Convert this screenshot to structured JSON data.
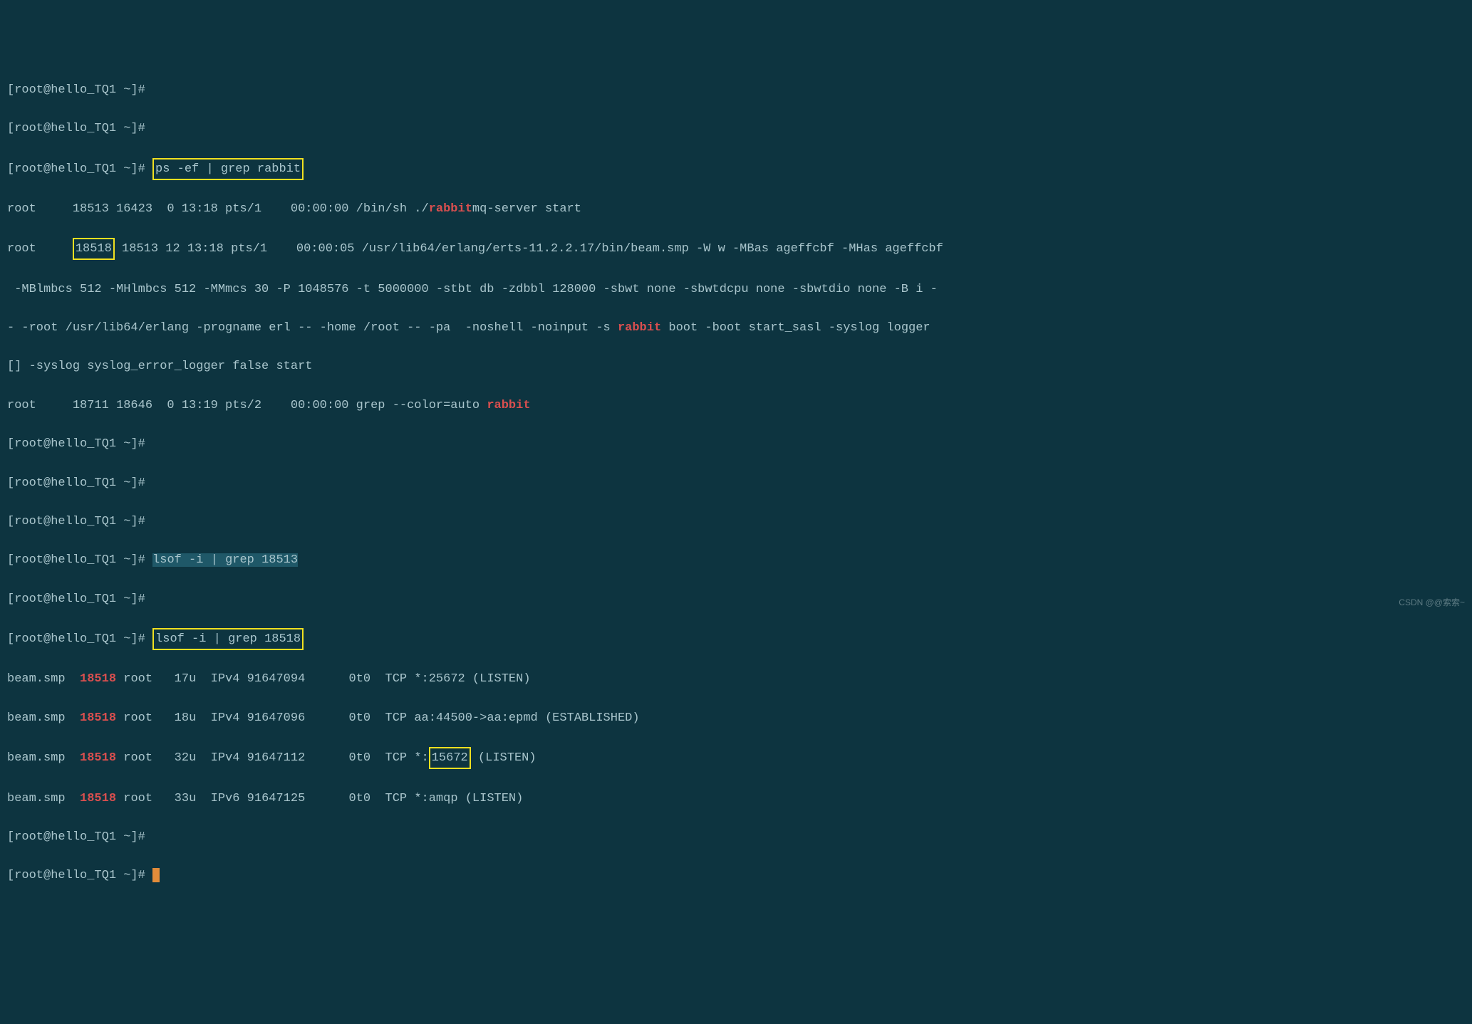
{
  "prompt_partial": "[root@hello_TQ1 ~]#",
  "prompt": "[root@hello_TQ1 ~]# ",
  "cmd1": "ps -ef | grep rabbit",
  "ps_line1_a": "root     18513 16423  0 13:18 pts/1    00:00:00 /bin/sh ./",
  "ps_line1_b": "rabbit",
  "ps_line1_c": "mq-server start",
  "ps_line2_a": "root     ",
  "ps_line2_pid": "18518",
  "ps_line2_b": " 18513 12 13:18 pts/1    00:00:05 /usr/lib64/erlang/erts-11.2.2.17/bin/beam.smp -W w -MBas ageffcbf -MHas ageffcbf",
  "ps_line3": " -MBlmbcs 512 -MHlmbcs 512 -MMmcs 30 -P 1048576 -t 5000000 -stbt db -zdbbl 128000 -sbwt none -sbwtdcpu none -sbwtdio none -B i -",
  "ps_line4_a": "- -root /usr/lib64/erlang -progname erl -- -home /root -- -pa  -noshell -noinput -s ",
  "ps_line4_b": "rabbit",
  "ps_line4_c": " boot -boot start_sasl -syslog logger",
  "ps_line5": "[] -syslog syslog_error_logger false start",
  "ps_line6_a": "root     18711 18646  0 13:19 pts/2    00:00:00 grep --color=auto ",
  "ps_line6_b": "rabbit",
  "cmd2": "lsof -i | grep 18513",
  "cmd3": "lsof -i | grep 18518",
  "lsof_line1_a": "beam.smp  ",
  "lsof_pid": "18518",
  "lsof_line1_b": " root   17u  IPv4 91647094      0t0  TCP *:25672 (LISTEN)",
  "lsof_line2_b": " root   18u  IPv4 91647096      0t0  TCP aa:44500->aa:epmd (ESTABLISHED)",
  "lsof_line3_b": " root   32u  IPv4 91647112      0t0  TCP *:",
  "lsof_line3_port": "15672",
  "lsof_line3_c": " (LISTEN)",
  "lsof_line4_b": " root   33u  IPv6 91647125      0t0  TCP *:amqp (LISTEN)",
  "watermark": "CSDN @@索索~"
}
